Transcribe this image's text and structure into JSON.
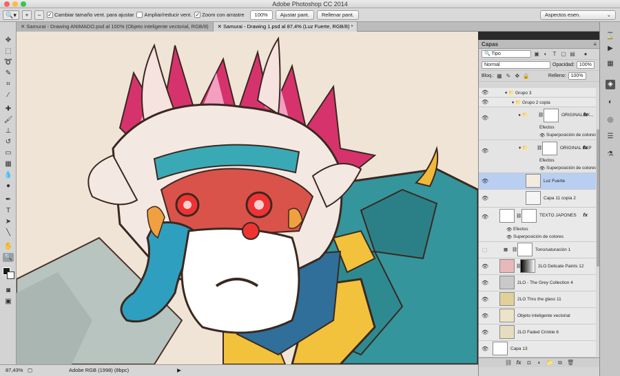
{
  "app_title": "Adobe Photoshop CC 2014",
  "options": {
    "fit_window_label": "Cambiar tamaño vent. para ajustar",
    "zoom_all_label": "Ampliar/reducir vent.",
    "scrubby_label": "Zoom con arrastre",
    "zoom_value": "100%",
    "fit_screen_label": "Ajustar pant.",
    "fill_screen_label": "Rellenar pant.",
    "workspace_label": "Aspectos esen."
  },
  "tabs": [
    {
      "label": "Samurai - Drawing ANIMADO.psd al 100% (Objeto inteligente vectorial, RGB/8)"
    },
    {
      "label": "Samurai - Drawing 1.psd al 87,4% (Luz Fuerte, RGB/8) *"
    }
  ],
  "status": {
    "zoom": "87,43%",
    "profile": "Adobe RGB (1998) (8bpc)"
  },
  "layers_panel": {
    "title": "Capas",
    "filter_label": "Tipo",
    "blend_mode": "Normal",
    "opacity_label": "Opacidad:",
    "opacity_value": "100%",
    "lock_label": "Bloq.:",
    "fill_label": "Relleno:",
    "fill_value": "100%",
    "layers": [
      {
        "name": "Grupo 3"
      },
      {
        "name": "Grupo 2 copia"
      },
      {
        "name": "ORIGINAL BK..."
      },
      {
        "name": "Efectos"
      },
      {
        "name": "Superposición de colores"
      },
      {
        "name": "ORIGINAL BKP"
      },
      {
        "name": "Efectos"
      },
      {
        "name": "Superposición de colores"
      },
      {
        "name": "Luz Fuerte"
      },
      {
        "name": "Capa 11 copia 2"
      },
      {
        "name": "TEXTO JAPONES"
      },
      {
        "name": "Efectos"
      },
      {
        "name": "Superposición de colores"
      },
      {
        "name": "Tono/saturación 1"
      },
      {
        "name": "2LO Delicate Paints 12"
      },
      {
        "name": "2LO - The Grey Collection 4"
      },
      {
        "name": "2LO Thru the glass 11"
      },
      {
        "name": "Objeto inteligente vectorial"
      },
      {
        "name": "2LO Faded Crinkle 6"
      },
      {
        "name": "Capa 13"
      }
    ]
  }
}
